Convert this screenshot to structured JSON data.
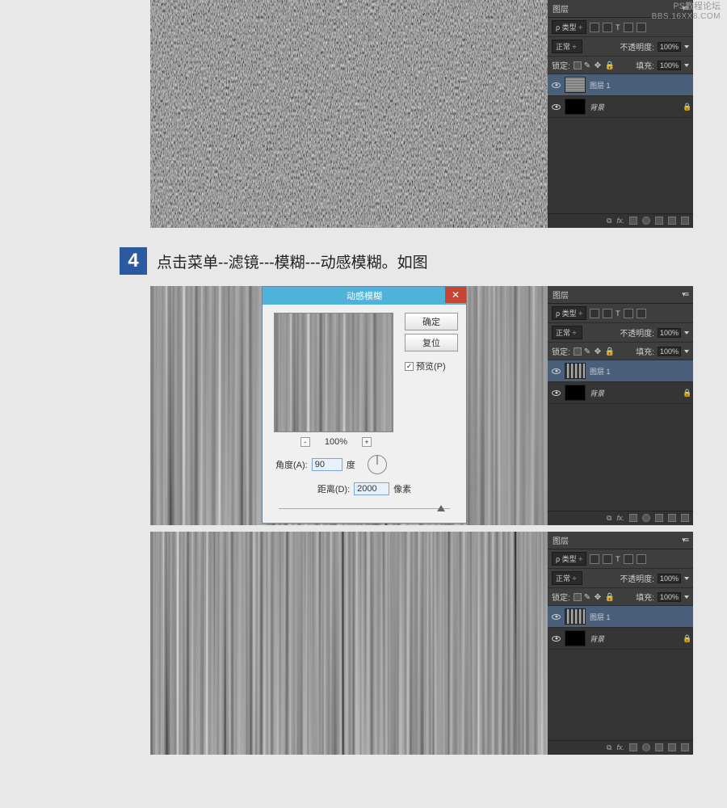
{
  "watermark": {
    "line1": "PS教程论坛",
    "line2": "BBS.16XX8.COM"
  },
  "step": {
    "number": "4",
    "text": "点击菜单--滤镜---模糊---动感模糊。如图"
  },
  "panel": {
    "title": "图层",
    "type_label": "类型",
    "blend_mode": "正常",
    "opacity_label": "不透明度:",
    "opacity_value": "100%",
    "lock_label": "锁定:",
    "fill_label": "填充:",
    "fill_value": "100%",
    "layers": [
      {
        "name": "图层 1"
      },
      {
        "name": "背景"
      }
    ]
  },
  "dialog": {
    "title": "动感模糊",
    "ok": "确定",
    "reset": "复位",
    "preview_label": "预览(P)",
    "zoom": "100%",
    "angle_label": "角度(A):",
    "angle_value": "90",
    "angle_unit": "度",
    "distance_label": "距离(D):",
    "distance_value": "2000",
    "distance_unit": "像素"
  }
}
